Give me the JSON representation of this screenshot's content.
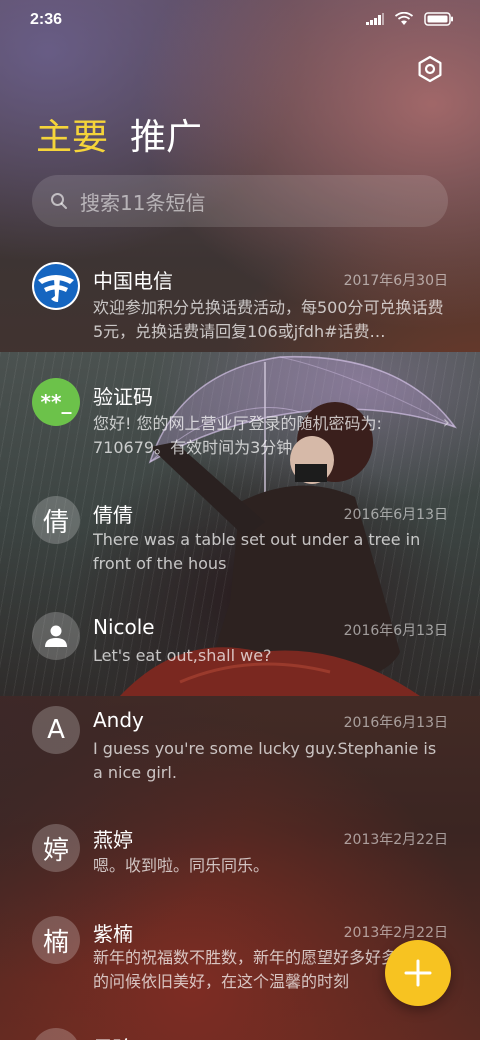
{
  "status": {
    "time": "2:36"
  },
  "header": {
    "tab_primary": "主要",
    "tab_promo": "推广"
  },
  "search": {
    "placeholder": "搜索11条短信"
  },
  "messages": [
    {
      "sender": "中国电信",
      "date": "2017年6月30日",
      "preview": "欢迎参加积分兑换话费活动，每500分可兑换话费5元，兑换话费请回复106或jfdh#话费…",
      "avatar_icon": "china-telecom-logo"
    },
    {
      "sender": "验证码",
      "preview": "您好! 您的网上营业厅登录的随机密码为: 710679。有效时间为3分钟",
      "avatar_text": "**_",
      "avatar_color": "#6cc24a"
    },
    {
      "sender": "倩倩",
      "date": "2016年6月13日",
      "preview": "There was a table set out under a tree in front of the hous",
      "avatar_text": "倩"
    },
    {
      "sender": "Nicole",
      "date": "2016年6月13日",
      "preview": "Let's eat out,shall we?",
      "avatar_icon": "person-icon"
    },
    {
      "sender": "Andy",
      "date": "2016年6月13日",
      "preview": "I guess you're some lucky guy.Stephanie is a nice girl.",
      "avatar_text": "A"
    },
    {
      "sender": "燕婷",
      "date": "2013年2月22日",
      "preview": "嗯。收到啦。同乐同乐。",
      "avatar_text": "婷"
    },
    {
      "sender": "紫楠",
      "date": "2013年2月22日",
      "preview": "新年的祝福数不胜数，新年的愿望好多好多，新年的问候依旧美好，在这个温馨的时刻",
      "avatar_text": "楠"
    },
    {
      "sender": "子玲",
      "avatar_text": ""
    }
  ],
  "fab": {
    "icon": "plus-icon",
    "color": "#f7c321"
  },
  "colors": {
    "accent_tab": "#f5d43a",
    "verification_avatar": "#6cc24a",
    "telecom_blue": "#1565c0"
  }
}
